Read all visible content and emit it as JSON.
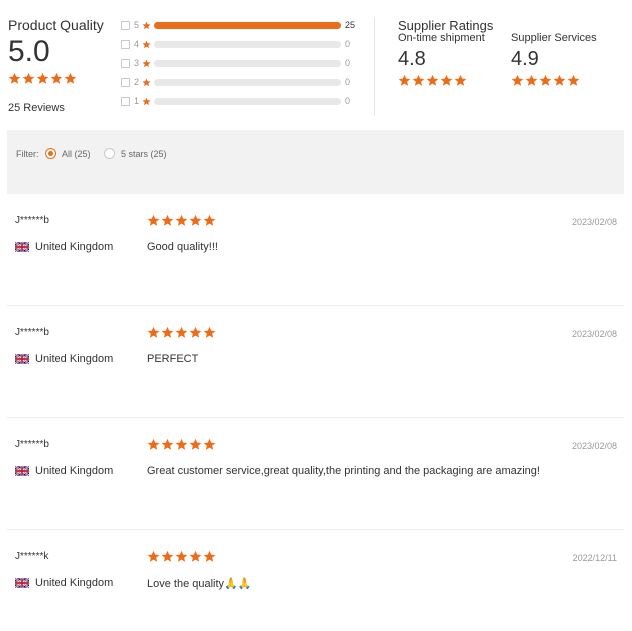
{
  "product_quality": {
    "title": "Product Quality",
    "score": "5.0",
    "rating": 5,
    "reviews_label": "25 Reviews"
  },
  "histogram": [
    {
      "stars": "5",
      "count": "25",
      "fraction": 1.0
    },
    {
      "stars": "4",
      "count": "0",
      "fraction": 0
    },
    {
      "stars": "3",
      "count": "0",
      "fraction": 0
    },
    {
      "stars": "2",
      "count": "0",
      "fraction": 0
    },
    {
      "stars": "1",
      "count": "0",
      "fraction": 0
    }
  ],
  "supplier_ratings": {
    "title": "Supplier Ratings",
    "items": [
      {
        "label": "On-time shipment",
        "score": "4.8",
        "rating": 5
      },
      {
        "label": "Supplier Services",
        "score": "4.9",
        "rating": 5
      }
    ]
  },
  "filter": {
    "label": "Filter:",
    "options": [
      {
        "label": "All (25)",
        "checked": true
      },
      {
        "label": "5 stars (25)",
        "checked": false
      }
    ]
  },
  "reviews": [
    {
      "reviewer": "J******b",
      "country": "United Kingdom",
      "rating": 5,
      "date": "2023/02/08",
      "text": "Good quality!!!"
    },
    {
      "reviewer": "J******b",
      "country": "United Kingdom",
      "rating": 5,
      "date": "2023/02/08",
      "text": "PERFECT"
    },
    {
      "reviewer": "J******b",
      "country": "United Kingdom",
      "rating": 5,
      "date": "2023/02/08",
      "text": "Great customer service,great quality,the printing and the packaging are amazing!"
    },
    {
      "reviewer": "J******k",
      "country": "United Kingdom",
      "rating": 5,
      "date": "2022/12/11",
      "text": "Love the quality🙏🙏"
    }
  ],
  "icons": {
    "star": "star-icon",
    "flag": "uk-flag-icon"
  },
  "colors": {
    "accent": "#ea6d1b",
    "track": "#e8e8e8",
    "filter_bg": "#f2f2f2"
  }
}
